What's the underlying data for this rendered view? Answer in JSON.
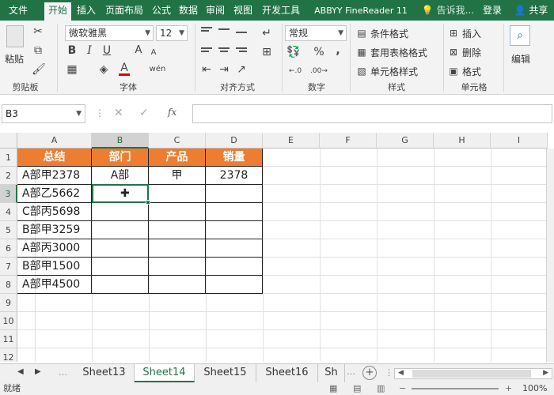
{
  "menu": {
    "file": "文件",
    "tabs": [
      "开始",
      "插入",
      "页面布局",
      "公式",
      "数据",
      "审阅",
      "视图",
      "开发工具",
      "ABBYY FineReader 11"
    ],
    "active_tab": "开始",
    "tell_me": "告诉我...",
    "login": "登录",
    "share": "共享"
  },
  "ribbon": {
    "paste_label": "粘贴",
    "font_name": "微软雅黑",
    "font_size": "12",
    "bold": "B",
    "italic": "I",
    "underline": "U",
    "font_color_letter": "A",
    "font_size_up": "A",
    "font_size_down": "A",
    "phonetic": "wén",
    "number_format": "常规",
    "percent": "%",
    "comma": ",",
    "conditional_format": "条件格式",
    "table_format": "套用表格格式",
    "cell_style": "单元格样式",
    "insert": "插入",
    "delete": "删除",
    "format": "格式",
    "edit": "编辑",
    "groups": {
      "clipboard": "剪贴板",
      "font": "字体",
      "alignment": "对齐方式",
      "number": "数字",
      "styles": "样式",
      "cells": "单元格"
    }
  },
  "formula_bar": {
    "name_box": "B3",
    "fx": "fx",
    "cancel": "✕",
    "confirm": "✓",
    "value": ""
  },
  "grid": {
    "columns": [
      "A",
      "B",
      "C",
      "D",
      "E",
      "F",
      "G",
      "H",
      "I"
    ],
    "rows": [
      "1",
      "2",
      "3",
      "4",
      "5",
      "6",
      "7",
      "8",
      "9",
      "10",
      "11",
      "12"
    ],
    "selected_column": "B",
    "selected_row": "3",
    "header_cells": [
      "总结",
      "部门",
      "产品",
      "销量"
    ],
    "data_rows": [
      [
        "A部甲2378",
        "A部",
        "甲",
        "2378"
      ],
      [
        "A部乙5662",
        "",
        "",
        ""
      ],
      [
        "C部丙5698",
        "",
        "",
        ""
      ],
      [
        "B部甲3259",
        "",
        "",
        ""
      ],
      [
        "A部丙3000",
        "",
        "",
        ""
      ],
      [
        "B部甲1500",
        "",
        "",
        ""
      ],
      [
        "A部甲4500",
        "",
        "",
        ""
      ]
    ],
    "header_color": "#ed7d31"
  },
  "sheets": {
    "tabs": [
      "Sheet13",
      "Sheet14",
      "Sheet15",
      "Sheet16",
      "Sh"
    ],
    "active": "Sheet14",
    "add": "+"
  },
  "status_bar": {
    "ready": "就绪",
    "zoom": "100%"
  },
  "colors": {
    "accent": "#217346",
    "header_fill": "#ed7d31"
  }
}
